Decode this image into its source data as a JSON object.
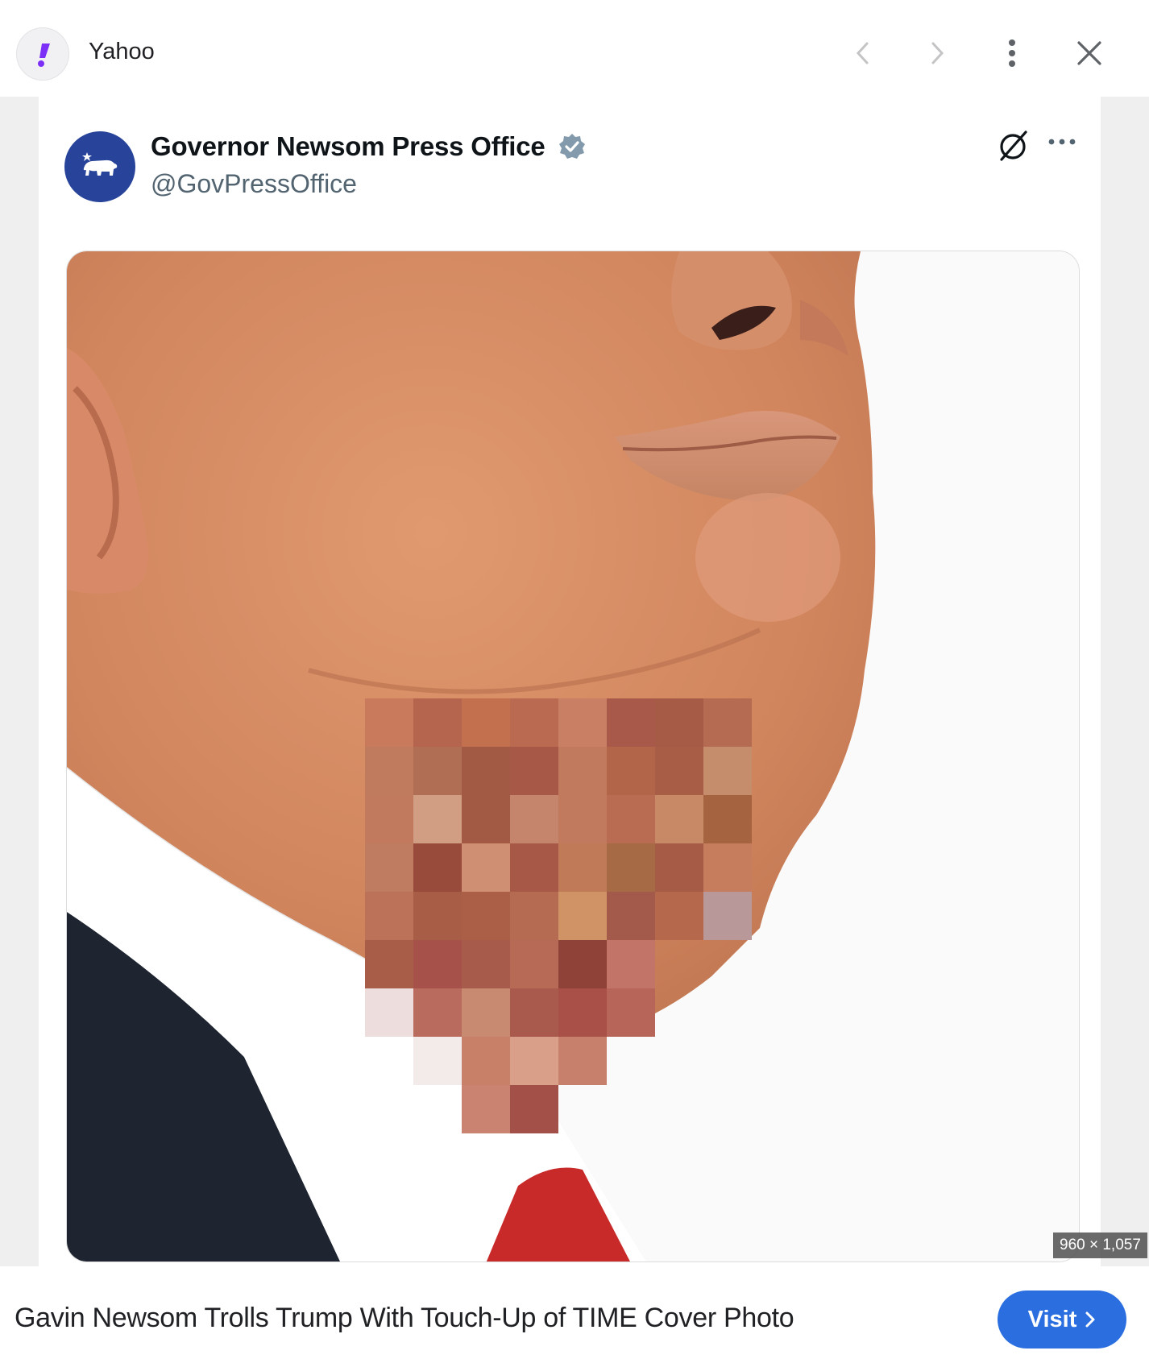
{
  "header": {
    "site_name": "Yahoo",
    "icons": [
      "yahoo-logo-icon",
      "chevron-left-icon",
      "chevron-right-icon",
      "more-vertical-icon",
      "close-icon"
    ]
  },
  "tweet": {
    "author_name": "Governor Newsom Press Office",
    "handle": "@GovPressOffice",
    "verified": true,
    "icons": [
      "grok-icon",
      "more-horizontal-icon"
    ]
  },
  "image": {
    "dimensions_label": "960 × 1,057"
  },
  "footer": {
    "caption": "Gavin Newsom Trolls Trump With Touch-Up of TIME Cover Photo",
    "visit_label": "Visit"
  },
  "colors": {
    "accent": "#2a6ee0",
    "avatar_bg": "#27449a",
    "yahoo_purple": "#7b2ff7",
    "verified": "#829aab"
  }
}
